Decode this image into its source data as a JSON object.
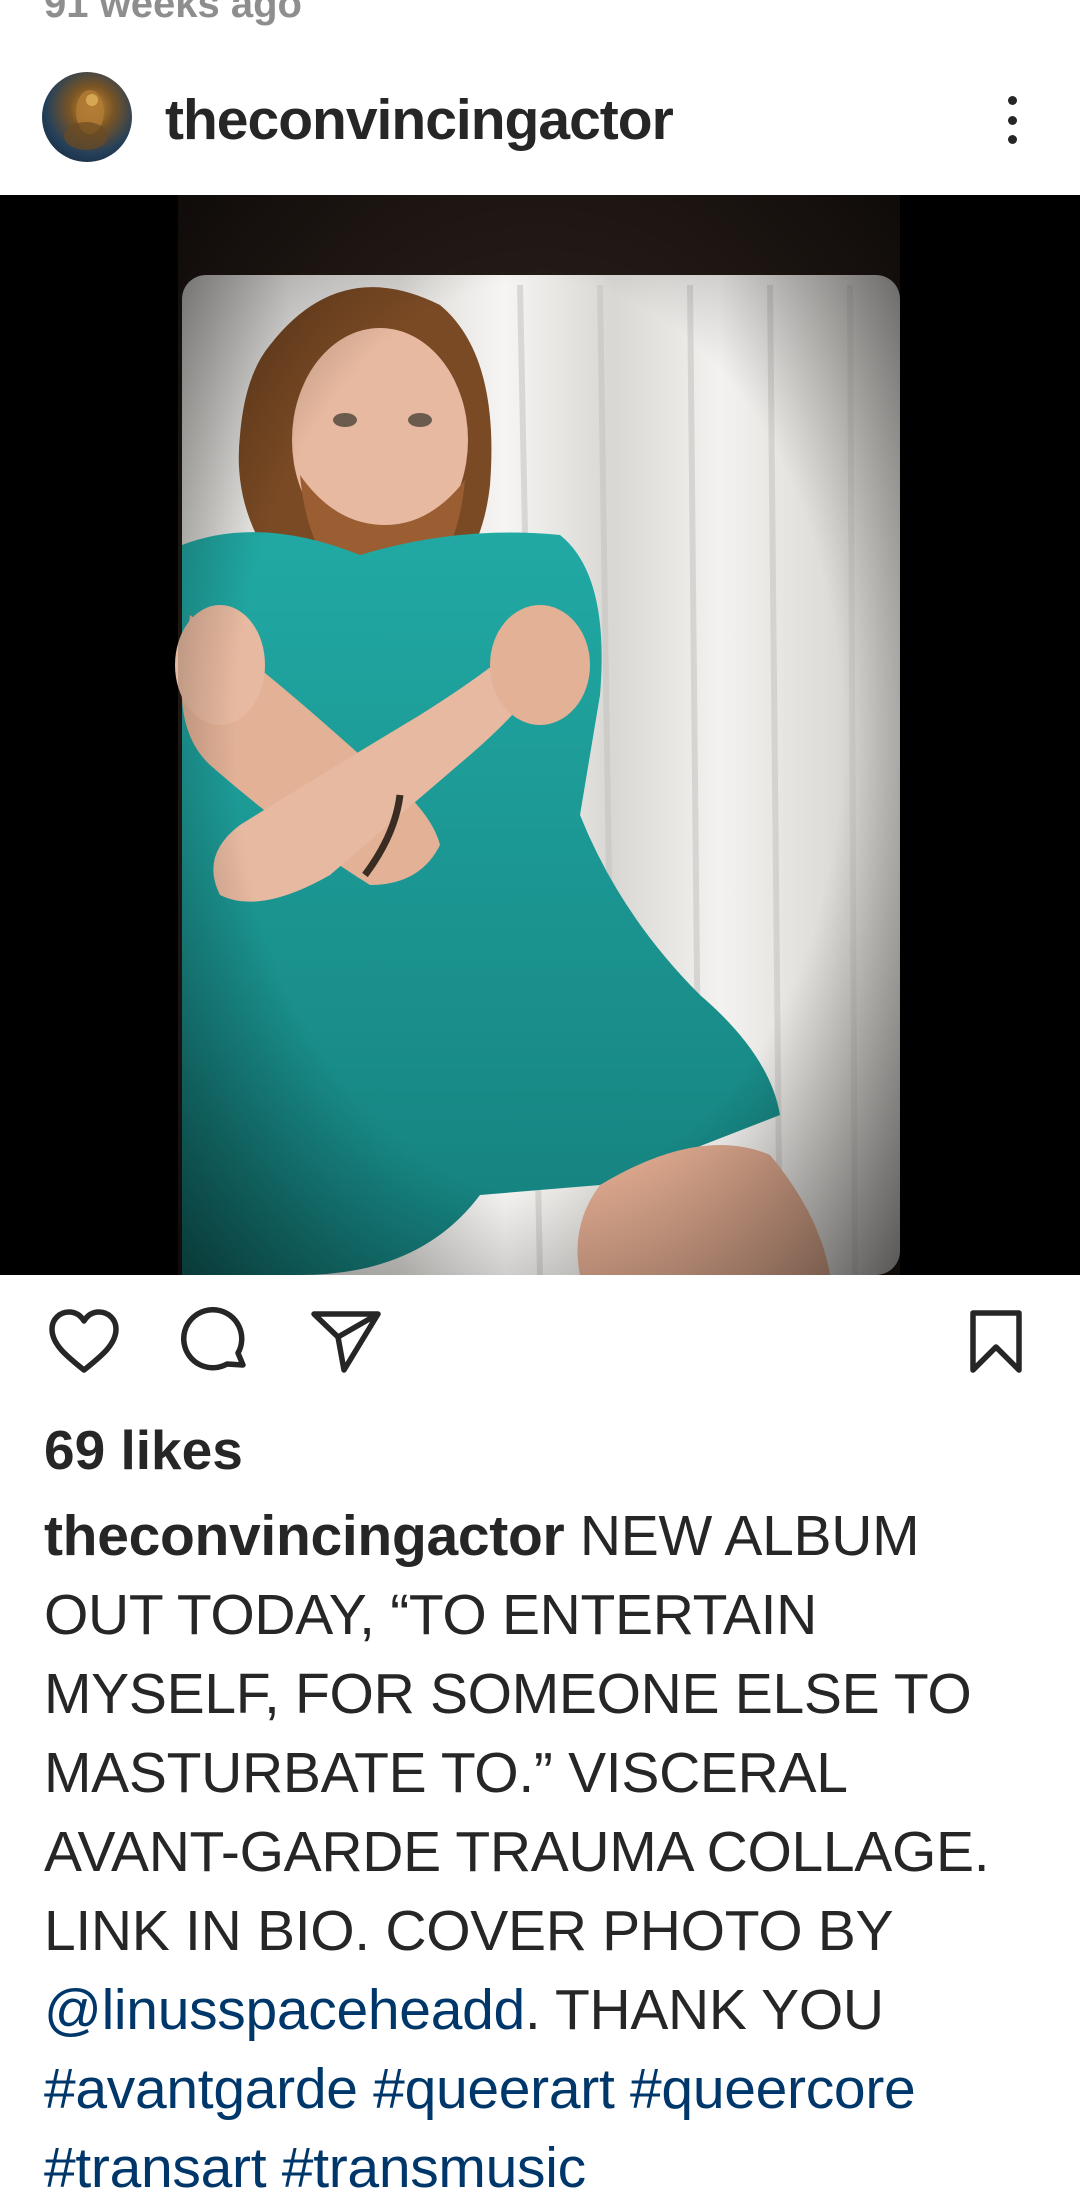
{
  "post": {
    "timestamp": "91 weeks ago",
    "username": "theconvincingactor",
    "likes": "69 likes",
    "caption": {
      "username": "theconvincingactor",
      "line1_text": " NEW ALBUM",
      "line2": "OUT TODAY, “TO ENTERTAIN",
      "line3": "MYSELF, FOR SOMEONE ELSE TO",
      "line4": "MASTURBATE TO.” VISCERAL",
      "line5": "AVANT-GARDE TRAUMA COLLAGE.",
      "line6": "LINK IN BIO. COVER PHOTO BY",
      "mention": "@linusspaceheadd",
      "line7_text": ". THANK YOU",
      "hashtags_line1": [
        "#avantgarde",
        "#queerart",
        "#queercore"
      ],
      "hashtags_line2": [
        "#transart",
        "#transmusic"
      ]
    }
  },
  "icons": {
    "more": "more-vertical-icon",
    "like": "heart-icon",
    "comment": "comment-icon",
    "share": "paper-plane-icon",
    "save": "bookmark-icon"
  },
  "colors": {
    "text": "#262626",
    "muted": "#8e8e8e",
    "link": "#00376b",
    "photo_background": "#000000",
    "dress": "#1a9a96"
  }
}
